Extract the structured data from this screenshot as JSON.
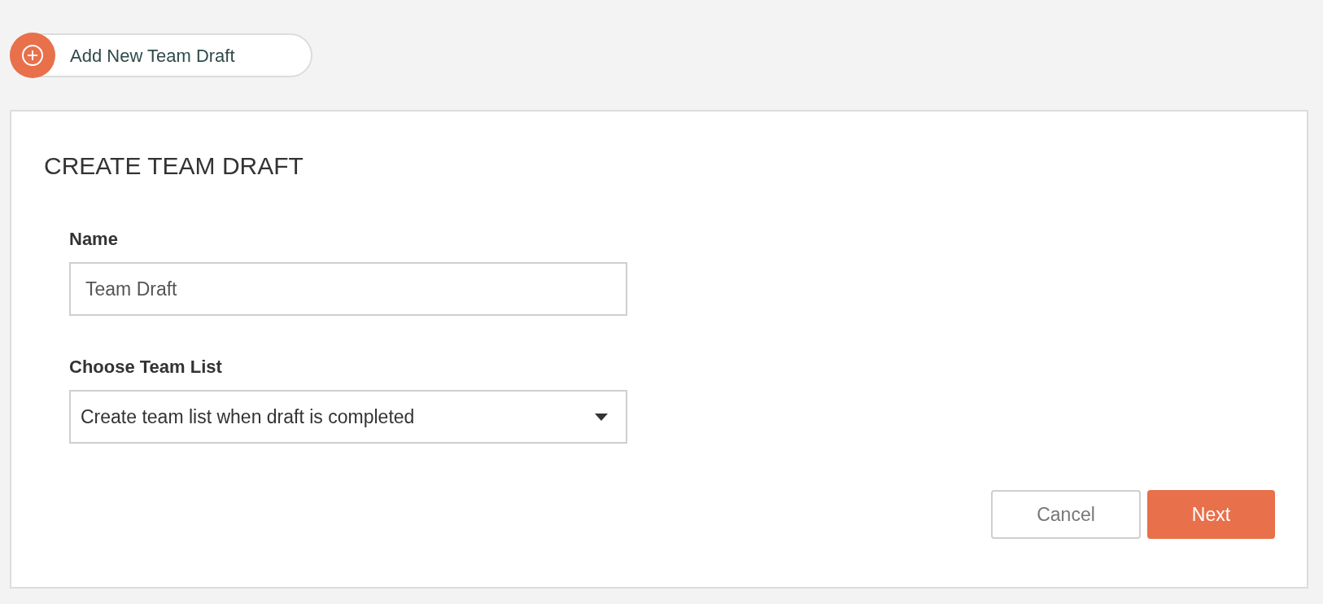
{
  "add_button": {
    "label": "Add New Team Draft"
  },
  "form": {
    "title": "CREATE TEAM DRAFT",
    "fields": [
      {
        "kind": "text",
        "label": "Name",
        "value": "Team Draft"
      },
      {
        "kind": "select",
        "label": "Choose Team List",
        "value": "Create team list when draft is completed"
      }
    ],
    "buttons": [
      {
        "kind": "secondary",
        "label": "Cancel"
      },
      {
        "kind": "primary",
        "label": "Next"
      }
    ]
  }
}
